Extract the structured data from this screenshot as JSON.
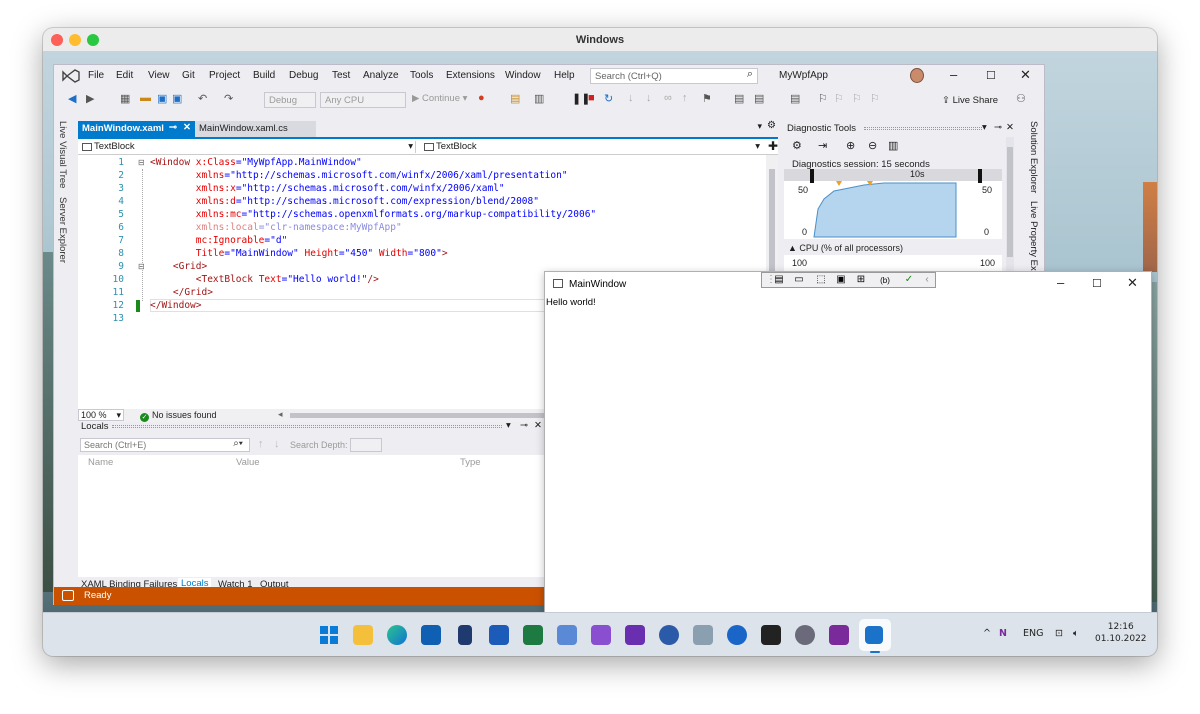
{
  "mac": {
    "title": "Windows"
  },
  "vs": {
    "menus": [
      "File",
      "Edit",
      "View",
      "Git",
      "Project",
      "Build",
      "Debug",
      "Test",
      "Analyze",
      "Tools",
      "Extensions",
      "Window",
      "Help"
    ],
    "search_placeholder": "Search (Ctrl+Q)",
    "project_name": "MyWpfApp",
    "toolbar": {
      "config": "Debug",
      "platform": "Any CPU",
      "continue_label": "Continue",
      "live_share": "Live Share"
    },
    "left_tabs": [
      "Live Visual Tree",
      "Server Explorer"
    ],
    "right_tabs": [
      "Solution Explorer",
      "Live Property Explo"
    ],
    "editor": {
      "tabs": [
        {
          "label": "MainWindow.xaml",
          "active": true
        },
        {
          "label": "MainWindow.xaml.cs",
          "active": false
        }
      ],
      "nav_left": "TextBlock",
      "nav_right": "TextBlock",
      "line_numbers": [
        "1",
        "2",
        "3",
        "4",
        "5",
        "6",
        "7",
        "8",
        "9",
        "10",
        "11",
        "12",
        "13"
      ],
      "lines": [
        "<Window x:Class=\"MyWpfApp.MainWindow\"",
        "        xmlns=\"http://schemas.microsoft.com/winfx/2006/xaml/presentation\"",
        "        xmlns:x=\"http://schemas.microsoft.com/winfx/2006/xaml\"",
        "        xmlns:d=\"http://schemas.microsoft.com/expression/blend/2008\"",
        "        xmlns:mc=\"http://schemas.openxmlformats.org/markup-compatibility/2006\"",
        "        xmlns:local=\"clr-namespace:MyWpfApp\"",
        "        mc:Ignorable=\"d\"",
        "        Title=\"MainWindow\" Height=\"450\" Width=\"800\">",
        "    <Grid>",
        "        <TextBlock Text=\"Hello world!\"/>",
        "    </Grid>",
        "</Window>",
        ""
      ],
      "zoom": "100 %",
      "issues": "No issues found"
    },
    "locals": {
      "title": "Locals",
      "search_placeholder": "Search (Ctrl+E)",
      "depth_label": "Search Depth:",
      "columns": [
        "Name",
        "Value",
        "Type"
      ],
      "bottom_tabs": [
        {
          "label": "XAML Binding Failures",
          "active": false
        },
        {
          "label": "Locals",
          "active": true
        },
        {
          "label": "Watch 1",
          "active": false
        },
        {
          "label": "Output",
          "active": false
        }
      ]
    },
    "diagnostics": {
      "title": "Diagnostic Tools",
      "session": "Diagnostics session: 15 seconds",
      "time_tick": "10s",
      "y_top": "50",
      "y_bottom": "0",
      "cpu_label": "CPU (% of all processors)",
      "cpu_top": "100"
    },
    "status": "Ready"
  },
  "wpf": {
    "title": "MainWindow",
    "text": "Hello world!"
  },
  "taskbar": {
    "lang": "ENG",
    "time": "12:16",
    "date": "01.10.2022"
  }
}
